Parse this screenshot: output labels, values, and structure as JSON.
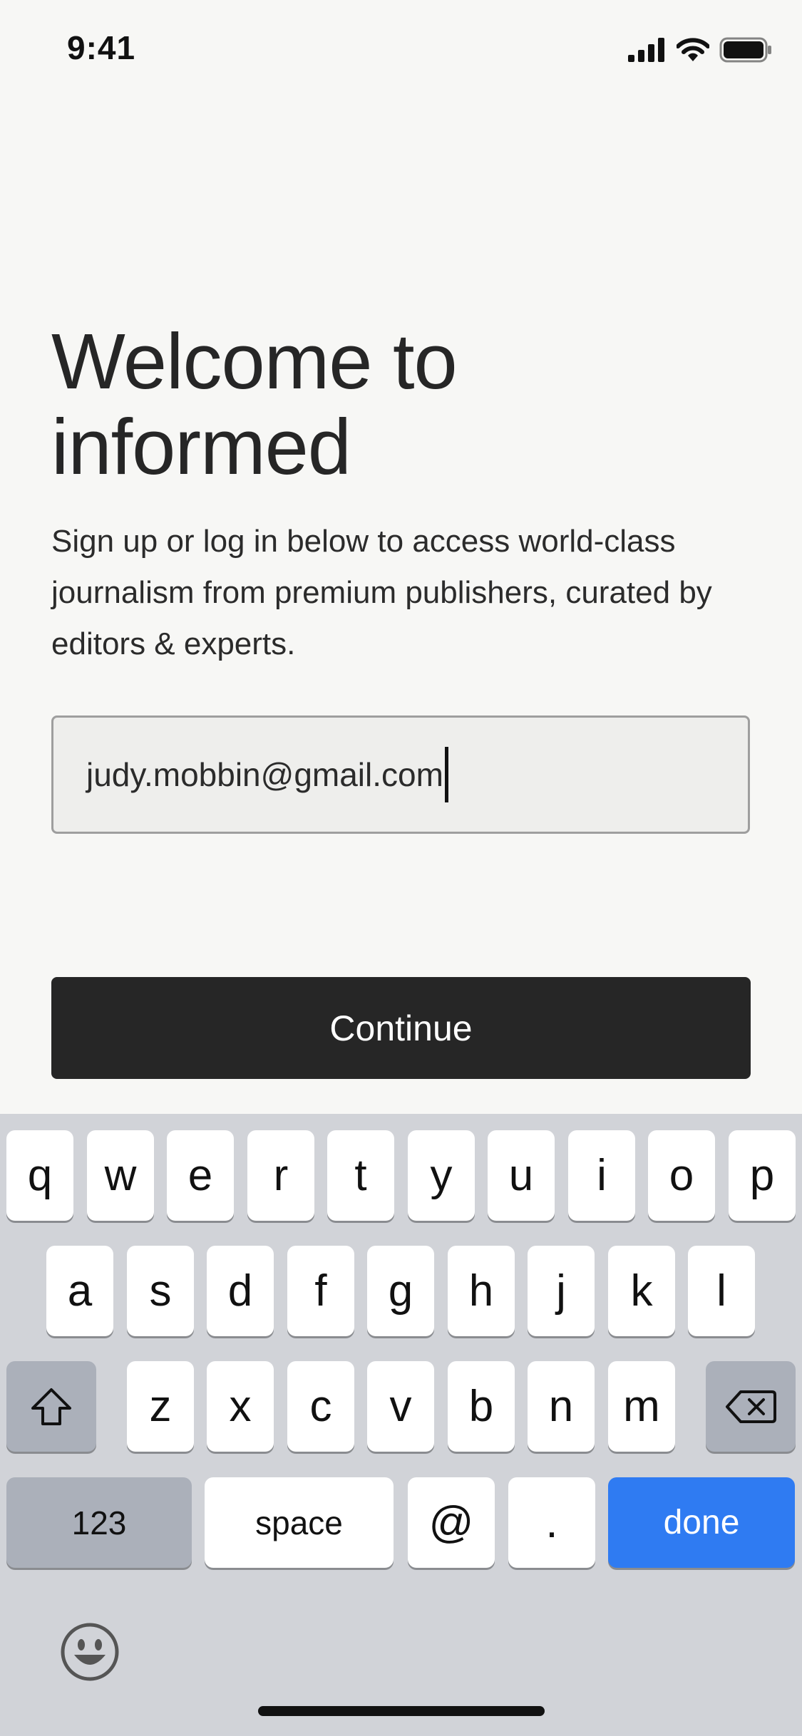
{
  "status_bar": {
    "time": "9:41",
    "icons": [
      "signal-icon",
      "wifi-icon",
      "battery-icon"
    ]
  },
  "welcome": {
    "title_line1": "Welcome to",
    "title_line2": "informed",
    "subtitle": "Sign up or log in below to access world-class journalism from premium publishers, curated by editors & experts."
  },
  "form": {
    "email_value": "judy.mobbin@gmail.com",
    "continue_label": "Continue"
  },
  "keyboard": {
    "row1": [
      "q",
      "w",
      "e",
      "r",
      "t",
      "y",
      "u",
      "i",
      "o",
      "p"
    ],
    "row2": [
      "a",
      "s",
      "d",
      "f",
      "g",
      "h",
      "j",
      "k",
      "l"
    ],
    "row3": [
      "z",
      "x",
      "c",
      "v",
      "b",
      "n",
      "m"
    ],
    "numbers_label": "123",
    "space_label": "space",
    "at_label": "@",
    "dot_label": ".",
    "done_label": "done",
    "special_icons": [
      "shift-icon",
      "backspace-icon",
      "emoji-icon"
    ]
  },
  "colors": {
    "background": "#f7f7f5",
    "button": "#262626",
    "keyboard": "#d1d3d8",
    "done_key": "#2f7bf2"
  }
}
